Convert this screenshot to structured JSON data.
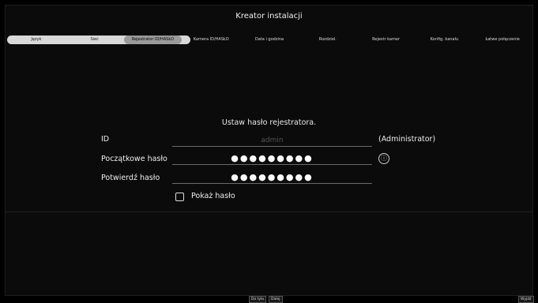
{
  "window": {
    "title": "Kreator instalacji"
  },
  "steps": [
    {
      "label": "Język"
    },
    {
      "label": "Sieć"
    },
    {
      "label": "Rejestrator ID/HASŁO"
    },
    {
      "label": "Kamera ID/HASŁO"
    },
    {
      "label": "Data i godzina"
    },
    {
      "label": "Rozdziel."
    },
    {
      "label": "Rejestr kamer"
    },
    {
      "label": "Konfig. kanału"
    },
    {
      "label": "Łatwe połączenie"
    }
  ],
  "form": {
    "heading": "Ustaw hasło rejestratora.",
    "id_label": "ID",
    "id_value": "admin",
    "id_note": "(Administrator)",
    "initial_password_label": "Początkowe hasło",
    "initial_password_mask": "●●●●●●●●●",
    "confirm_password_label": "Potwierdź hasło",
    "confirm_password_mask": "●●●●●●●●●",
    "show_password_label": "Pokaż hasło",
    "info_icon": "ⓘ"
  },
  "footer": {
    "back_label": "Do tyłu",
    "next_label": "Dalej",
    "exit_label": "Wyjdź"
  }
}
